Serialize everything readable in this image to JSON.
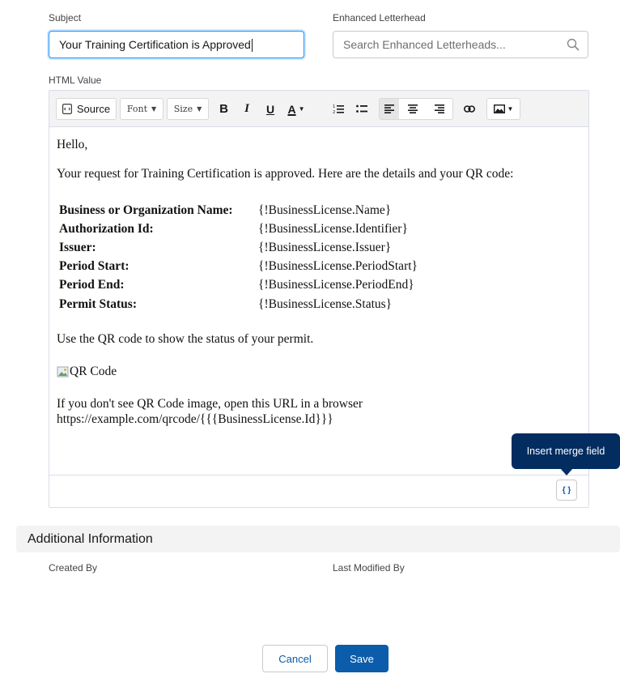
{
  "form": {
    "subject_label": "Subject",
    "subject_value": "Your Training Certification is Approved",
    "letterhead_label": "Enhanced Letterhead",
    "letterhead_placeholder": "Search Enhanced Letterheads...",
    "html_value_label": "HTML Value"
  },
  "toolbar": {
    "source_label": "Source",
    "font_label": "Font",
    "size_label": "Size",
    "bold_label": "B",
    "italic_label": "I",
    "underline_label": "U",
    "text_color_label": "A"
  },
  "email": {
    "greeting": "Hello,",
    "intro": "Your request for Training Certification is approved. Here are the details and your QR code:",
    "details": [
      {
        "key": "Business or Organization Name:",
        "value": "{!BusinessLicense.Name}"
      },
      {
        "key": "Authorization Id:",
        "value": "{!BusinessLicense.Identifier}"
      },
      {
        "key": "Issuer:",
        "value": "{!BusinessLicense.Issuer}"
      },
      {
        "key": "Period Start:",
        "value": "{!BusinessLicense.PeriodStart}"
      },
      {
        "key": "Period End:",
        "value": "{!BusinessLicense.PeriodEnd}"
      },
      {
        "key": "Permit Status:",
        "value": "{!BusinessLicense.Status}"
      }
    ],
    "qr_note": "Use the QR code to show the status of your permit.",
    "qr_alt": "QR Code",
    "url_line1": "If you don't see QR Code image, open this URL in a browser",
    "url_line2": "https://example.com/qrcode/{{{BusinessLicense.Id}}}"
  },
  "merge_field": {
    "tooltip": "Insert merge field",
    "button_label": "{ }"
  },
  "additional": {
    "header": "Additional Information",
    "created_by_label": "Created By",
    "last_modified_label": "Last Modified By"
  },
  "actions": {
    "cancel_label": "Cancel",
    "save_label": "Save"
  },
  "colors": {
    "brand": "#0b5cab",
    "focus": "#1b96ff",
    "tooltip_bg": "#032d60"
  }
}
